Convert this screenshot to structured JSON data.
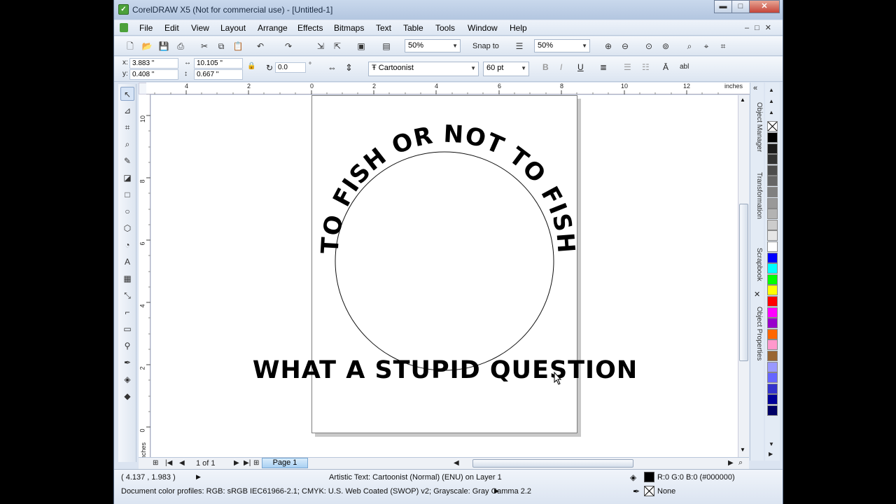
{
  "window": {
    "title": "CorelDRAW X5 (Not for commercial use) - [Untitled-1]",
    "buttons": {
      "minimize": "▬",
      "maximize": "□",
      "close": "✕"
    }
  },
  "menu": [
    "File",
    "Edit",
    "View",
    "Layout",
    "Arrange",
    "Effects",
    "Bitmaps",
    "Text",
    "Table",
    "Tools",
    "Window",
    "Help"
  ],
  "toolbar": {
    "zoom1": "50%",
    "snap_label": "Snap to",
    "zoom2": "50%"
  },
  "propbar": {
    "x_label": "x:",
    "x_value": "3.883 \"",
    "y_label": "y:",
    "y_value": "0.408 \"",
    "w_value": "10.105 \"",
    "h_value": "0.667 \"",
    "angle_value": "0.0",
    "angle_unit": "°",
    "font_name": "Cartoonist",
    "font_size": "60 pt"
  },
  "ruler": {
    "h_ticks": [
      "4",
      "2",
      "0",
      "2",
      "4",
      "6",
      "8",
      "10",
      "12"
    ],
    "h_unit": "inches",
    "v_ticks": [
      "10",
      "8",
      "6",
      "4",
      "2",
      "0"
    ],
    "v_unit": "inches"
  },
  "canvas": {
    "arc_text": "TO FISH OR NOT TO FISH",
    "bottom_text": "WHAT A STUPID QUESTION"
  },
  "pagenav": {
    "count": "1 of 1",
    "tab": "Page 1"
  },
  "dockers": [
    "Object Manager",
    "Transformation",
    "Scrapbook",
    "Object Properties"
  ],
  "palette": [
    "#000000",
    "#1a1a1a",
    "#333333",
    "#4d4d4d",
    "#666666",
    "#808080",
    "#999999",
    "#b3b3b3",
    "#cccccc",
    "#e6e6e6",
    "#ffffff",
    "#0000ff",
    "#00ffff",
    "#00ff00",
    "#ffff00",
    "#ff0000",
    "#ff00ff",
    "#9900cc",
    "#ff6600",
    "#ff99cc",
    "#996633",
    "#9999ff",
    "#6666ff",
    "#3333cc",
    "#000099",
    "#000066"
  ],
  "status": {
    "coords": "( 4.137 , 1.983 )",
    "object_info": "Artistic Text: Cartoonist (Normal) (ENU) on Layer 1",
    "fill_info": "R:0 G:0 B:0 (#000000)",
    "outline_info": "None",
    "color_profiles": "Document color profiles: RGB: sRGB IEC61966-2.1; CMYK: U.S. Web Coated (SWOP) v2; Grayscale: Gray Gamma 2.2"
  }
}
